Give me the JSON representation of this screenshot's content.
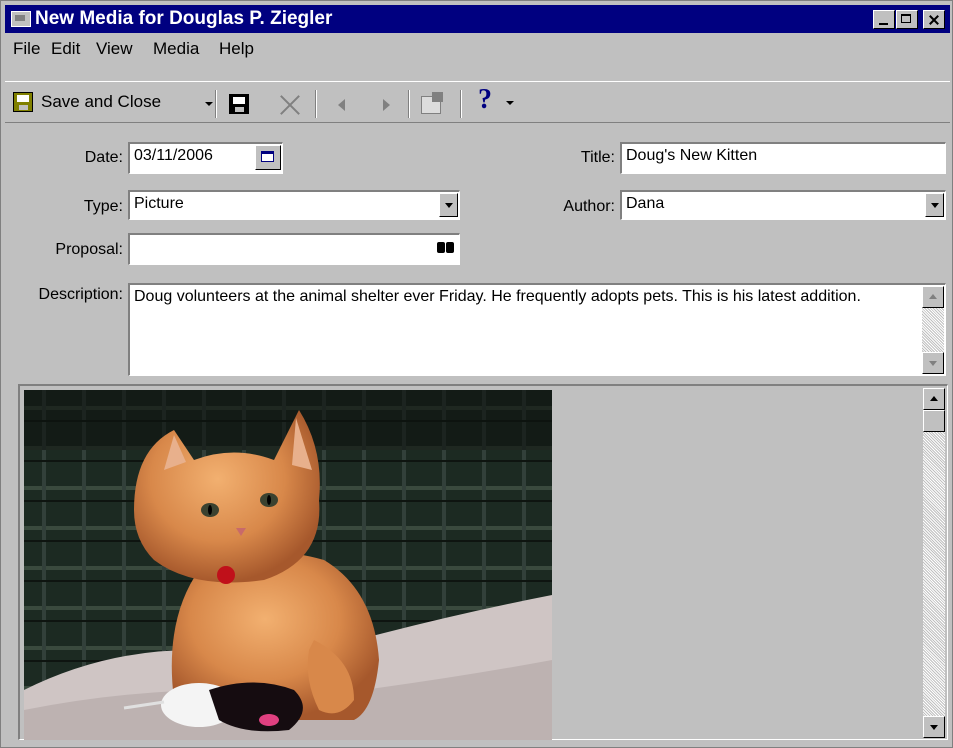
{
  "window": {
    "title": "New Media for Douglas P. Ziegler"
  },
  "menu": [
    "File",
    "Edit",
    "View",
    "Media",
    "Help"
  ],
  "toolbar": {
    "save_close_label": "Save and Close",
    "help_glyph": "?"
  },
  "form": {
    "date_label": "Date:",
    "date_value": "03/11/2006",
    "title_label": "Title:",
    "title_value": "Doug's New Kitten",
    "type_label": "Type:",
    "type_value": "Picture",
    "author_label": "Author:",
    "author_value": "Dana",
    "proposal_label": "Proposal:",
    "proposal_value": "",
    "description_label": "Description:",
    "description_value": "Doug volunteers at the animal shelter ever Friday.  He frequently adopts pets.  This is his latest addition."
  },
  "media": {
    "image_subject": "orange-kitten-photo"
  },
  "colors": {
    "titlebar": "#000080",
    "chrome": "#c0c0c0",
    "field_bg": "#ffffff"
  }
}
